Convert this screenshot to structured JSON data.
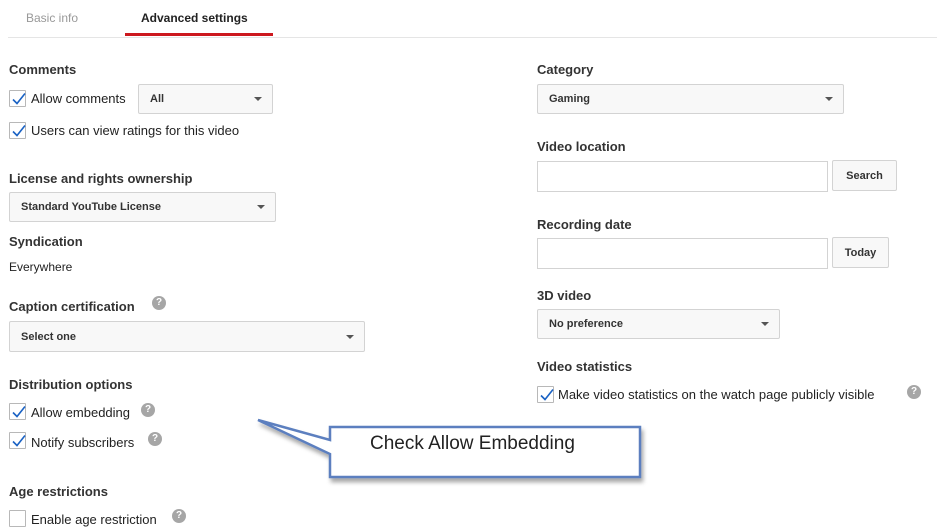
{
  "tabs": [
    {
      "label": "Basic info",
      "active": false
    },
    {
      "label": "Advanced settings",
      "active": true
    }
  ],
  "left": {
    "comments": {
      "heading": "Comments",
      "allow_comments": {
        "label": "Allow comments",
        "checked": true
      },
      "allow_comments_select": "All",
      "view_ratings": {
        "label": "Users can view ratings for this video",
        "checked": true
      }
    },
    "license": {
      "heading": "License and rights ownership",
      "select": "Standard YouTube License"
    },
    "syndication": {
      "heading": "Syndication",
      "value": "Everywhere"
    },
    "caption": {
      "heading": "Caption certification",
      "select": "Select one"
    },
    "distribution": {
      "heading": "Distribution options",
      "allow_embedding": {
        "label": "Allow embedding",
        "checked": true
      },
      "notify_subscribers": {
        "label": "Notify subscribers",
        "checked": true
      }
    },
    "age": {
      "heading": "Age restrictions",
      "enable_age_restriction": {
        "label": "Enable age restriction",
        "checked": false
      }
    }
  },
  "right": {
    "category": {
      "heading": "Category",
      "select": "Gaming"
    },
    "video_location": {
      "heading": "Video location",
      "value": "",
      "button": "Search"
    },
    "recording_date": {
      "heading": "Recording date",
      "value": "",
      "button": "Today"
    },
    "video_3d": {
      "heading": "3D video",
      "select": "No preference"
    },
    "video_statistics": {
      "heading": "Video statistics",
      "public_stats": {
        "label": "Make video statistics on the watch page publicly visible",
        "checked": true
      }
    }
  },
  "callout": {
    "text": "Check Allow Embedding"
  },
  "icons": {
    "help": "?",
    "help_name": "help-icon",
    "check_name": "checkmark-icon"
  },
  "colors": {
    "active_tab_underline": "#cc181e",
    "callout_border": "#5b7fbf",
    "checkmark": "#1a62c4"
  }
}
